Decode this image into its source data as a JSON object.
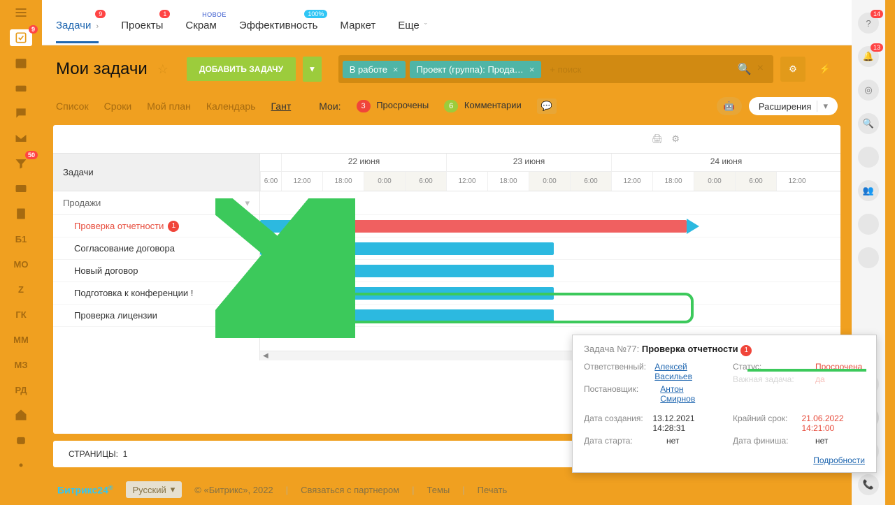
{
  "left_rail": {
    "tasks_badge": "9",
    "filter_badge": "50",
    "text_items": [
      "Б1",
      "МО",
      "Z",
      "ГК",
      "ММ",
      "МЗ",
      "РД"
    ]
  },
  "right_rail": {
    "help_badge": "14",
    "bell_badge": "13"
  },
  "topnav": {
    "tasks": "Задачи",
    "tasks_badge": "9",
    "projects": "Проекты",
    "projects_badge": "1",
    "scrum": "Скрам",
    "scrum_tag": "НОВОЕ",
    "efficiency": "Эффективность",
    "efficiency_tag": "100%",
    "market": "Маркет",
    "more": "Еще"
  },
  "header": {
    "title": "Мои задачи",
    "add_button": "ДОБАВИТЬ ЗАДАЧУ",
    "filter_chips": [
      "В работе",
      "Проект (группа): Прода…"
    ],
    "filter_placeholder": "+ поиск",
    "gear": "gear",
    "bolt": "bolt"
  },
  "views": {
    "list": "Список",
    "deadlines": "Сроки",
    "myplan": "Мой план",
    "calendar": "Календарь",
    "gantt": "Гант",
    "my_label": "Мои:",
    "overdue_count": "3",
    "overdue_label": "Просрочены",
    "comments_count": "6",
    "comments_label": "Комментарии",
    "extensions": "Расширения"
  },
  "gantt": {
    "tasks_col": "Задачи",
    "group": "Продажи",
    "tasks": [
      {
        "name": "Проверка отчетности",
        "overdue": true,
        "badge": "1"
      },
      {
        "name": "Согласование договора"
      },
      {
        "name": "Новый договор"
      },
      {
        "name": "Подготовка к конференции !"
      },
      {
        "name": "Проверка лицензии"
      }
    ],
    "dates": [
      "22 июня",
      "23 июня",
      "24 июня"
    ],
    "times": [
      "6:00",
      "12:00",
      "18:00",
      "0:00",
      "6:00",
      "12:00",
      "18:00",
      "0:00",
      "6:00",
      "12:00",
      "18:00",
      "0:00",
      "6:00",
      "12:00"
    ]
  },
  "task_card": {
    "title_prefix": "Задача №77:",
    "title": "Проверка отчетности",
    "title_badge": "1",
    "rows": {
      "responsible_lbl": "Ответственный:",
      "responsible": "Алексей Васильев",
      "creator_lbl": "Постановщик:",
      "creator": "Антон Смирнов",
      "status_lbl": "Статус:",
      "status": "Просрочена",
      "important_lbl": "Важная задача:",
      "important": "да",
      "created_lbl": "Дата создания:",
      "created": "13.12.2021 14:28:31",
      "start_lbl": "Дата старта:",
      "start": "нет",
      "deadline_lbl": "Крайний срок:",
      "deadline": "21.06.2022 14:21:00",
      "finish_lbl": "Дата финиша:",
      "finish": "нет"
    },
    "details": "Подробности"
  },
  "pager": {
    "label": "СТРАНИЦЫ:",
    "page": "1"
  },
  "footer": {
    "brand": "Битрикс24",
    "lang": "Русский",
    "copyright": "© «Битрикс», 2022",
    "contact": "Связаться с партнером",
    "themes": "Темы",
    "print": "Печать"
  }
}
